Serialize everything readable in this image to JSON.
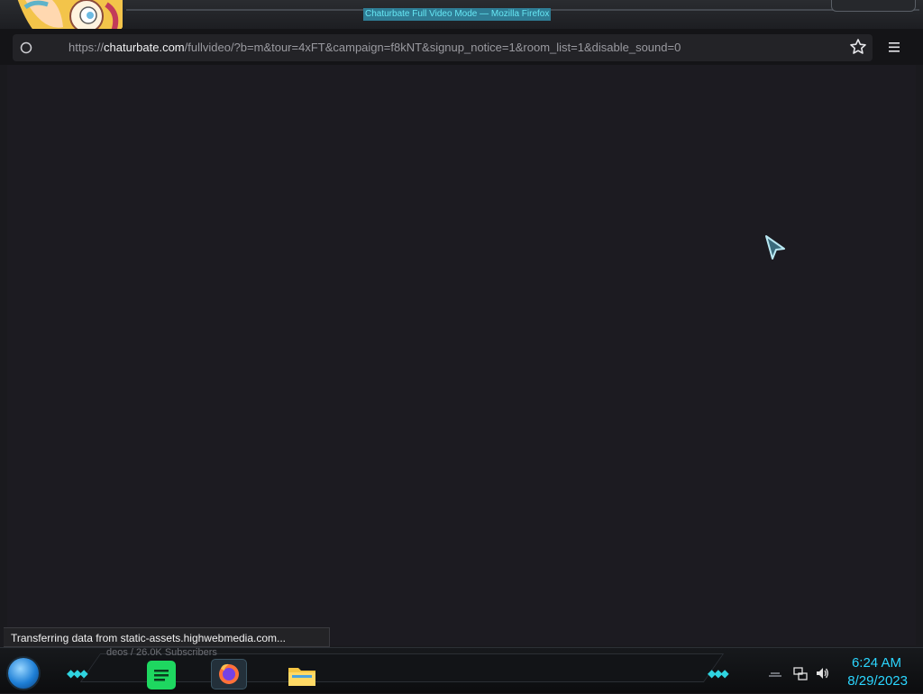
{
  "window": {
    "title": "Chaturbate Full Video Mode — Mozilla Firefox"
  },
  "toolbar": {
    "url_scheme": "https://",
    "url_host": "chaturbate.com",
    "url_rest": "/fullvideo/?b=m&tour=4xFT&campaign=f8kNT&signup_notice=1&room_list=1&disable_sound=0",
    "bookmark_icon": "star-icon",
    "menu_icon": "hamburger-menu-icon"
  },
  "status_bar": {
    "text": "Transferring data from static-assets.highwebmedia.com..."
  },
  "underlay": {
    "text": "deos / 26.0K Subscribers"
  },
  "taskbar": {
    "apps": [
      {
        "name": "Spotify",
        "icon": "spotify-icon"
      },
      {
        "name": "Firefox",
        "icon": "firefox-icon"
      },
      {
        "name": "File Explorer",
        "icon": "folder-icon"
      }
    ],
    "clock": {
      "time": "6:24 AM",
      "date": "8/29/2023"
    }
  },
  "colors": {
    "accent": "#2bd6ff",
    "spotify": "#1ed760",
    "content_bg": "#1c1b21"
  }
}
